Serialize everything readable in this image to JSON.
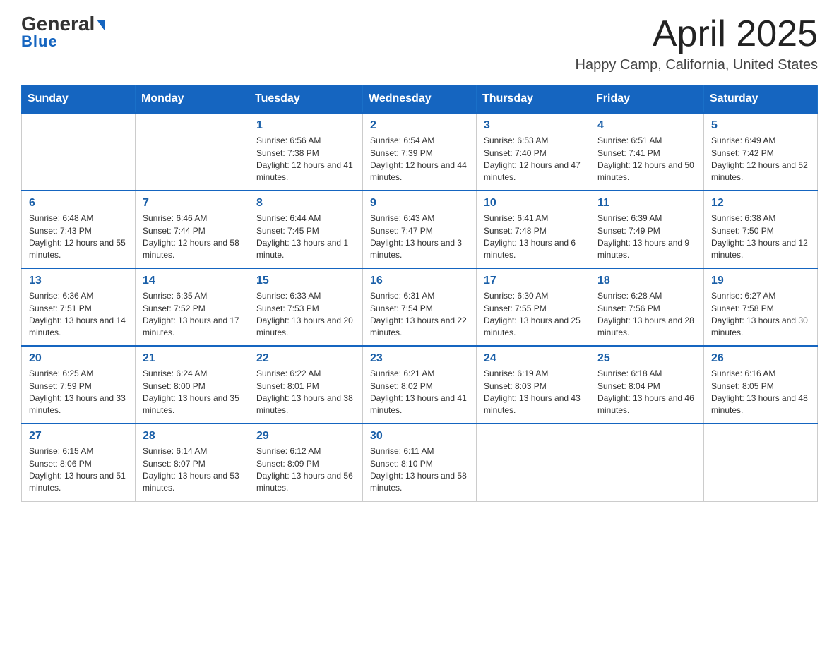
{
  "header": {
    "logo_general": "General",
    "logo_blue": "Blue",
    "month": "April 2025",
    "location": "Happy Camp, California, United States"
  },
  "weekdays": [
    "Sunday",
    "Monday",
    "Tuesday",
    "Wednesday",
    "Thursday",
    "Friday",
    "Saturday"
  ],
  "weeks": [
    [
      {
        "day": "",
        "sunrise": "",
        "sunset": "",
        "daylight": ""
      },
      {
        "day": "",
        "sunrise": "",
        "sunset": "",
        "daylight": ""
      },
      {
        "day": "1",
        "sunrise": "Sunrise: 6:56 AM",
        "sunset": "Sunset: 7:38 PM",
        "daylight": "Daylight: 12 hours and 41 minutes."
      },
      {
        "day": "2",
        "sunrise": "Sunrise: 6:54 AM",
        "sunset": "Sunset: 7:39 PM",
        "daylight": "Daylight: 12 hours and 44 minutes."
      },
      {
        "day": "3",
        "sunrise": "Sunrise: 6:53 AM",
        "sunset": "Sunset: 7:40 PM",
        "daylight": "Daylight: 12 hours and 47 minutes."
      },
      {
        "day": "4",
        "sunrise": "Sunrise: 6:51 AM",
        "sunset": "Sunset: 7:41 PM",
        "daylight": "Daylight: 12 hours and 50 minutes."
      },
      {
        "day": "5",
        "sunrise": "Sunrise: 6:49 AM",
        "sunset": "Sunset: 7:42 PM",
        "daylight": "Daylight: 12 hours and 52 minutes."
      }
    ],
    [
      {
        "day": "6",
        "sunrise": "Sunrise: 6:48 AM",
        "sunset": "Sunset: 7:43 PM",
        "daylight": "Daylight: 12 hours and 55 minutes."
      },
      {
        "day": "7",
        "sunrise": "Sunrise: 6:46 AM",
        "sunset": "Sunset: 7:44 PM",
        "daylight": "Daylight: 12 hours and 58 minutes."
      },
      {
        "day": "8",
        "sunrise": "Sunrise: 6:44 AM",
        "sunset": "Sunset: 7:45 PM",
        "daylight": "Daylight: 13 hours and 1 minute."
      },
      {
        "day": "9",
        "sunrise": "Sunrise: 6:43 AM",
        "sunset": "Sunset: 7:47 PM",
        "daylight": "Daylight: 13 hours and 3 minutes."
      },
      {
        "day": "10",
        "sunrise": "Sunrise: 6:41 AM",
        "sunset": "Sunset: 7:48 PM",
        "daylight": "Daylight: 13 hours and 6 minutes."
      },
      {
        "day": "11",
        "sunrise": "Sunrise: 6:39 AM",
        "sunset": "Sunset: 7:49 PM",
        "daylight": "Daylight: 13 hours and 9 minutes."
      },
      {
        "day": "12",
        "sunrise": "Sunrise: 6:38 AM",
        "sunset": "Sunset: 7:50 PM",
        "daylight": "Daylight: 13 hours and 12 minutes."
      }
    ],
    [
      {
        "day": "13",
        "sunrise": "Sunrise: 6:36 AM",
        "sunset": "Sunset: 7:51 PM",
        "daylight": "Daylight: 13 hours and 14 minutes."
      },
      {
        "day": "14",
        "sunrise": "Sunrise: 6:35 AM",
        "sunset": "Sunset: 7:52 PM",
        "daylight": "Daylight: 13 hours and 17 minutes."
      },
      {
        "day": "15",
        "sunrise": "Sunrise: 6:33 AM",
        "sunset": "Sunset: 7:53 PM",
        "daylight": "Daylight: 13 hours and 20 minutes."
      },
      {
        "day": "16",
        "sunrise": "Sunrise: 6:31 AM",
        "sunset": "Sunset: 7:54 PM",
        "daylight": "Daylight: 13 hours and 22 minutes."
      },
      {
        "day": "17",
        "sunrise": "Sunrise: 6:30 AM",
        "sunset": "Sunset: 7:55 PM",
        "daylight": "Daylight: 13 hours and 25 minutes."
      },
      {
        "day": "18",
        "sunrise": "Sunrise: 6:28 AM",
        "sunset": "Sunset: 7:56 PM",
        "daylight": "Daylight: 13 hours and 28 minutes."
      },
      {
        "day": "19",
        "sunrise": "Sunrise: 6:27 AM",
        "sunset": "Sunset: 7:58 PM",
        "daylight": "Daylight: 13 hours and 30 minutes."
      }
    ],
    [
      {
        "day": "20",
        "sunrise": "Sunrise: 6:25 AM",
        "sunset": "Sunset: 7:59 PM",
        "daylight": "Daylight: 13 hours and 33 minutes."
      },
      {
        "day": "21",
        "sunrise": "Sunrise: 6:24 AM",
        "sunset": "Sunset: 8:00 PM",
        "daylight": "Daylight: 13 hours and 35 minutes."
      },
      {
        "day": "22",
        "sunrise": "Sunrise: 6:22 AM",
        "sunset": "Sunset: 8:01 PM",
        "daylight": "Daylight: 13 hours and 38 minutes."
      },
      {
        "day": "23",
        "sunrise": "Sunrise: 6:21 AM",
        "sunset": "Sunset: 8:02 PM",
        "daylight": "Daylight: 13 hours and 41 minutes."
      },
      {
        "day": "24",
        "sunrise": "Sunrise: 6:19 AM",
        "sunset": "Sunset: 8:03 PM",
        "daylight": "Daylight: 13 hours and 43 minutes."
      },
      {
        "day": "25",
        "sunrise": "Sunrise: 6:18 AM",
        "sunset": "Sunset: 8:04 PM",
        "daylight": "Daylight: 13 hours and 46 minutes."
      },
      {
        "day": "26",
        "sunrise": "Sunrise: 6:16 AM",
        "sunset": "Sunset: 8:05 PM",
        "daylight": "Daylight: 13 hours and 48 minutes."
      }
    ],
    [
      {
        "day": "27",
        "sunrise": "Sunrise: 6:15 AM",
        "sunset": "Sunset: 8:06 PM",
        "daylight": "Daylight: 13 hours and 51 minutes."
      },
      {
        "day": "28",
        "sunrise": "Sunrise: 6:14 AM",
        "sunset": "Sunset: 8:07 PM",
        "daylight": "Daylight: 13 hours and 53 minutes."
      },
      {
        "day": "29",
        "sunrise": "Sunrise: 6:12 AM",
        "sunset": "Sunset: 8:09 PM",
        "daylight": "Daylight: 13 hours and 56 minutes."
      },
      {
        "day": "30",
        "sunrise": "Sunrise: 6:11 AM",
        "sunset": "Sunset: 8:10 PM",
        "daylight": "Daylight: 13 hours and 58 minutes."
      },
      {
        "day": "",
        "sunrise": "",
        "sunset": "",
        "daylight": ""
      },
      {
        "day": "",
        "sunrise": "",
        "sunset": "",
        "daylight": ""
      },
      {
        "day": "",
        "sunrise": "",
        "sunset": "",
        "daylight": ""
      }
    ]
  ]
}
